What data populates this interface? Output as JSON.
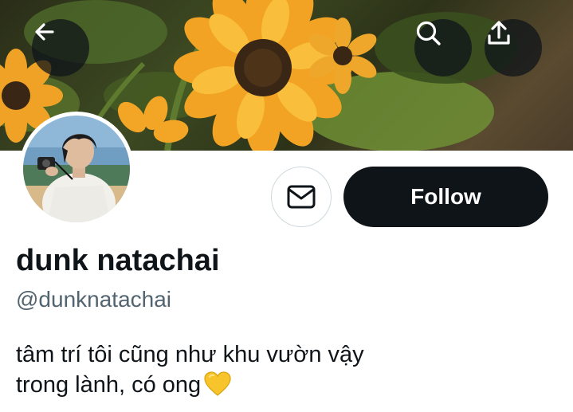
{
  "profile": {
    "display_name": "dunk natachai",
    "handle": "@dunknatachai",
    "bio_line1": "tâm trí tôi cũng như khu vườn vậy",
    "bio_line2": "trong lành, có ong"
  },
  "actions": {
    "follow_label": "Follow"
  },
  "icons": {
    "back": "arrow-left-icon",
    "search": "search-icon",
    "share": "share-upload-icon",
    "message": "envelope-icon",
    "bio_emoji": "yellow-heart-icon"
  },
  "colors": {
    "follow_bg": "#0f1419",
    "follow_text": "#ffffff",
    "handle_text": "#536471",
    "heart": "#f7c52b"
  }
}
